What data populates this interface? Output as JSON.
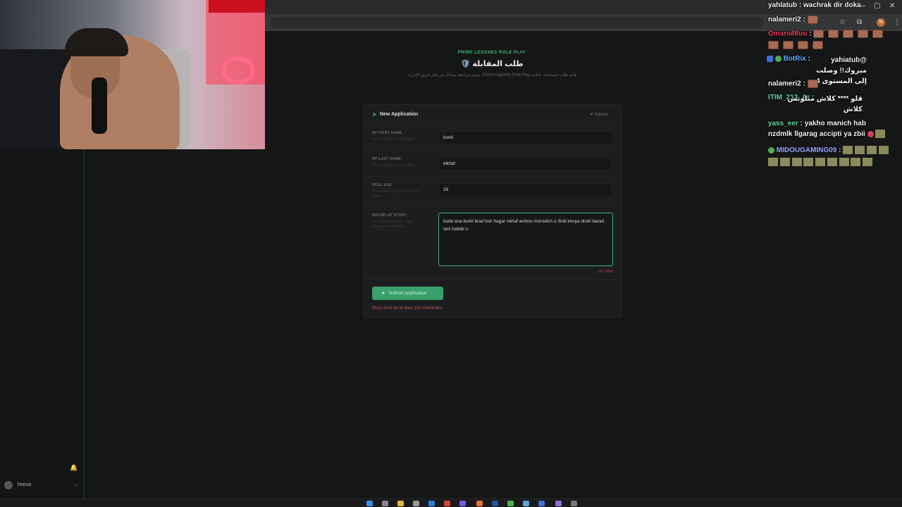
{
  "browser": {
    "controls": {
      "minimize": "—",
      "maximize": "▢",
      "close": "✕"
    },
    "profile_initial": "N"
  },
  "page": {
    "kicker": "PRIME LEGENDS ROLE PLAY",
    "title": "طلب المقابلة",
    "subtitle": "قدّم طلب انضمامك لخادم Prime Legends Role Play، سيتم مراجعة بياناتك من قبل فريق الإدارة."
  },
  "form": {
    "title": "New Application",
    "cancel_label": "✕ Cancel",
    "fields": [
      {
        "label": "RP FIRST NAME",
        "hint": "Your character's first name",
        "value": "burkl"
      },
      {
        "label": "RP LAST NAME",
        "hint": "Your character's last name",
        "value": "elkfati"
      },
      {
        "label": "REAL AGE",
        "hint": "Your actual age. Must be 16 or older.",
        "value": "26"
      }
    ],
    "story": {
      "label": "ROLEPLAY STORY",
      "hint": "Min. 100 characters. Your character's backstory.",
      "value": "burkl ana burkl brad bsh hagar nkhaf wshno mnrodich o 3ndi khoya drukl barad tani habibi n",
      "counter": "89 / 3000"
    },
    "submit_label": "Submit Application",
    "error": "Story must be at least 100 characters."
  },
  "sidebar": {
    "user": "hoova"
  },
  "chat": [
    {
      "user": "yahlatub",
      "color": "#f2f2f2",
      "message": "wachrak dir doka",
      "emotes": 0
    },
    {
      "user": "nalameri2",
      "color": "#f2f2f2",
      "message": "",
      "emotes": 1
    },
    {
      "user": "Omaro88uu",
      "color": "#e0405a",
      "message": "",
      "emotes": 9
    },
    {
      "user": "BotRix",
      "color": "#5fb0ff",
      "message": "@yahiatub مبروك!! وصلت إلى المستوى 4",
      "emotes": 0
    },
    {
      "user": "nalameri2",
      "color": "#f2f2f2",
      "message": "",
      "emotes": 1
    },
    {
      "user": "ITIM_213_Ar",
      "color": "#68d6a0",
      "message": "قلو **** كلاش متلوتش كلاش",
      "emotes": 0
    },
    {
      "user": "yass_eer",
      "color": "#68d6a0",
      "message": "yakho manich hab nzdmlk llgarag accipti ya zbii",
      "emotes": 0
    },
    {
      "user": "MIDOUGAMING09",
      "color": "#9fa8ff",
      "message": "",
      "emotes": 11
    }
  ]
}
